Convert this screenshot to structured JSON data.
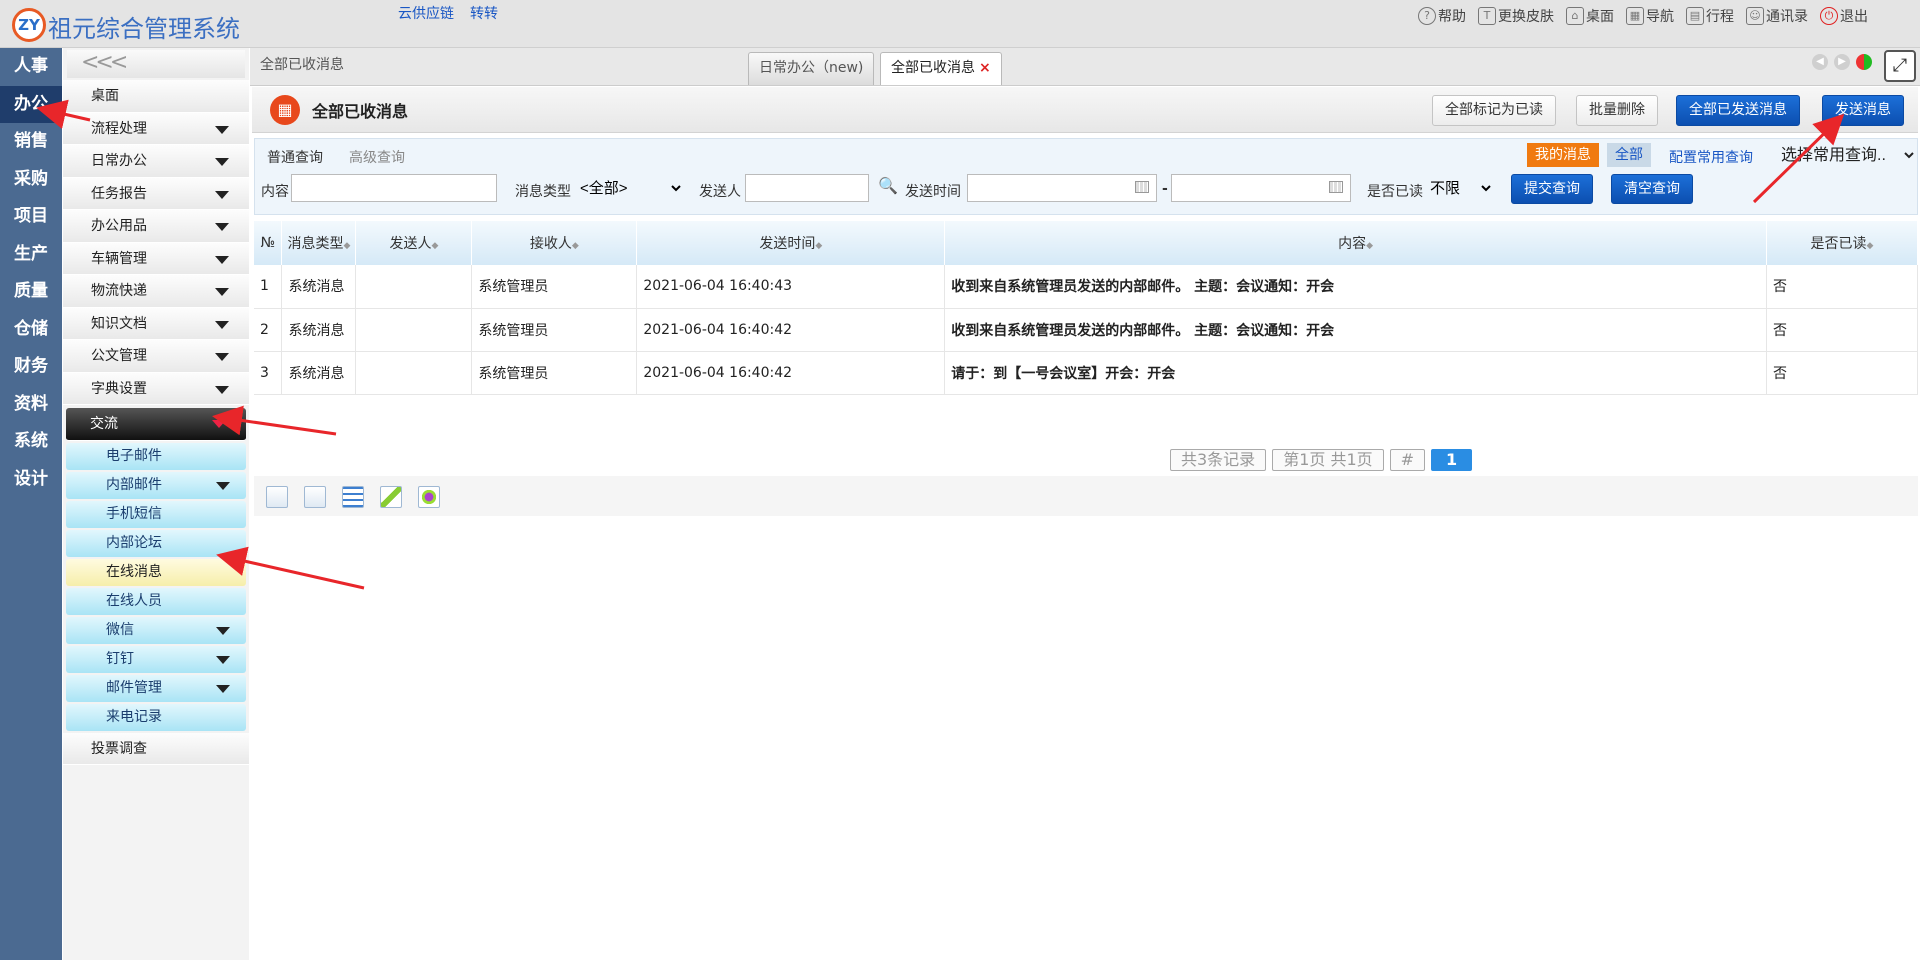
{
  "header": {
    "logo_text": "ZY",
    "app_title": "祖元综合管理系统",
    "links": [
      "云供应链",
      "转转"
    ],
    "right_links": [
      {
        "icon": "help-icon",
        "glyph": "?",
        "label": "帮助"
      },
      {
        "icon": "shirt-icon",
        "glyph": "T",
        "label": "更换皮肤"
      },
      {
        "icon": "home-icon",
        "glyph": "⌂",
        "label": "桌面"
      },
      {
        "icon": "grid-icon",
        "glyph": "▦",
        "label": "导航"
      },
      {
        "icon": "calendar-icon",
        "glyph": "▤",
        "label": "行程"
      },
      {
        "icon": "contacts-icon",
        "glyph": "☺",
        "label": "通讯录"
      },
      {
        "icon": "power-icon",
        "glyph": "⏻",
        "label": "退出"
      }
    ]
  },
  "modules": [
    "人事",
    "办公",
    "销售",
    "采购",
    "项目",
    "生产",
    "质量",
    "仓储",
    "财务",
    "资料",
    "系统",
    "设计"
  ],
  "active_module": "办公",
  "submenu": {
    "collapse": "<<<",
    "items": [
      {
        "label": "桌面",
        "caret": false
      },
      {
        "label": "流程处理",
        "caret": true
      },
      {
        "label": "日常办公",
        "caret": true
      },
      {
        "label": "任务报告",
        "caret": true
      },
      {
        "label": "办公用品",
        "caret": true
      },
      {
        "label": "车辆管理",
        "caret": true
      },
      {
        "label": "物流快递",
        "caret": true
      },
      {
        "label": "知识文档",
        "caret": true
      },
      {
        "label": "公文管理",
        "caret": true
      },
      {
        "label": "字典设置",
        "caret": true
      }
    ],
    "group": "交流",
    "group_items": [
      {
        "label": "电子邮件",
        "caret": false
      },
      {
        "label": "内部邮件",
        "caret": true
      },
      {
        "label": "手机短信",
        "caret": false
      },
      {
        "label": "内部论坛",
        "caret": false
      },
      {
        "label": "在线消息",
        "caret": false,
        "current": true
      },
      {
        "label": "在线人员",
        "caret": false
      },
      {
        "label": "微信",
        "caret": true
      },
      {
        "label": "钉钉",
        "caret": true
      },
      {
        "label": "邮件管理",
        "caret": true
      },
      {
        "label": "来电记录",
        "caret": false
      }
    ],
    "last_item": "投票调查"
  },
  "tabbar": {
    "crumb": "全部已收消息",
    "tabs": [
      {
        "label": "日常办公（new)"
      },
      {
        "label": "全部已收消息",
        "close": "×"
      }
    ],
    "expand": "⤢"
  },
  "page": {
    "icon": "▦",
    "title": "全部已收消息",
    "buttons": [
      "全部标记为已读",
      "批量删除",
      "全部已发送消息",
      "发送消息"
    ]
  },
  "search": {
    "tab_normal": "普通查询",
    "tab_advanced": "高级查询",
    "my_msg": "我的消息",
    "all_msg": "全部",
    "config_query": "配置常用查询",
    "saved_query": "选择常用查询..",
    "content_label": "内容",
    "type_label": "消息类型",
    "type_value": "<全部>",
    "sender_label": "发送人",
    "time_label": "发送时间",
    "time_sep": "-",
    "read_label": "是否已读",
    "read_value": "不限",
    "submit": "提交查询",
    "clear": "清空查询"
  },
  "table": {
    "headers": [
      "№",
      "消息类型",
      "发送人",
      "接收人",
      "发送时间",
      "内容",
      "是否已读"
    ],
    "rows": [
      [
        "1",
        "系统消息",
        "",
        "系统管理员",
        "2021-06-04 16:40:43",
        "收到来自系统管理员发送的内部邮件。 主题：会议通知：开会",
        "否"
      ],
      [
        "2",
        "系统消息",
        "",
        "系统管理员",
        "2021-06-04 16:40:42",
        "收到来自系统管理员发送的内部邮件。 主题：会议通知：开会",
        "否"
      ],
      [
        "3",
        "系统消息",
        "",
        "系统管理员",
        "2021-06-04 16:40:42",
        "请于：到【一号会议室】开会：开会",
        "否"
      ]
    ]
  },
  "pager": {
    "total": "共3条记录",
    "pages": "第1页 共1页",
    "hash": "#",
    "current": "1"
  },
  "colors": {
    "accent": "#0c4fb0",
    "nav": "#4b6a91",
    "orange": "#f07a10",
    "arrow": "#e8262a"
  }
}
